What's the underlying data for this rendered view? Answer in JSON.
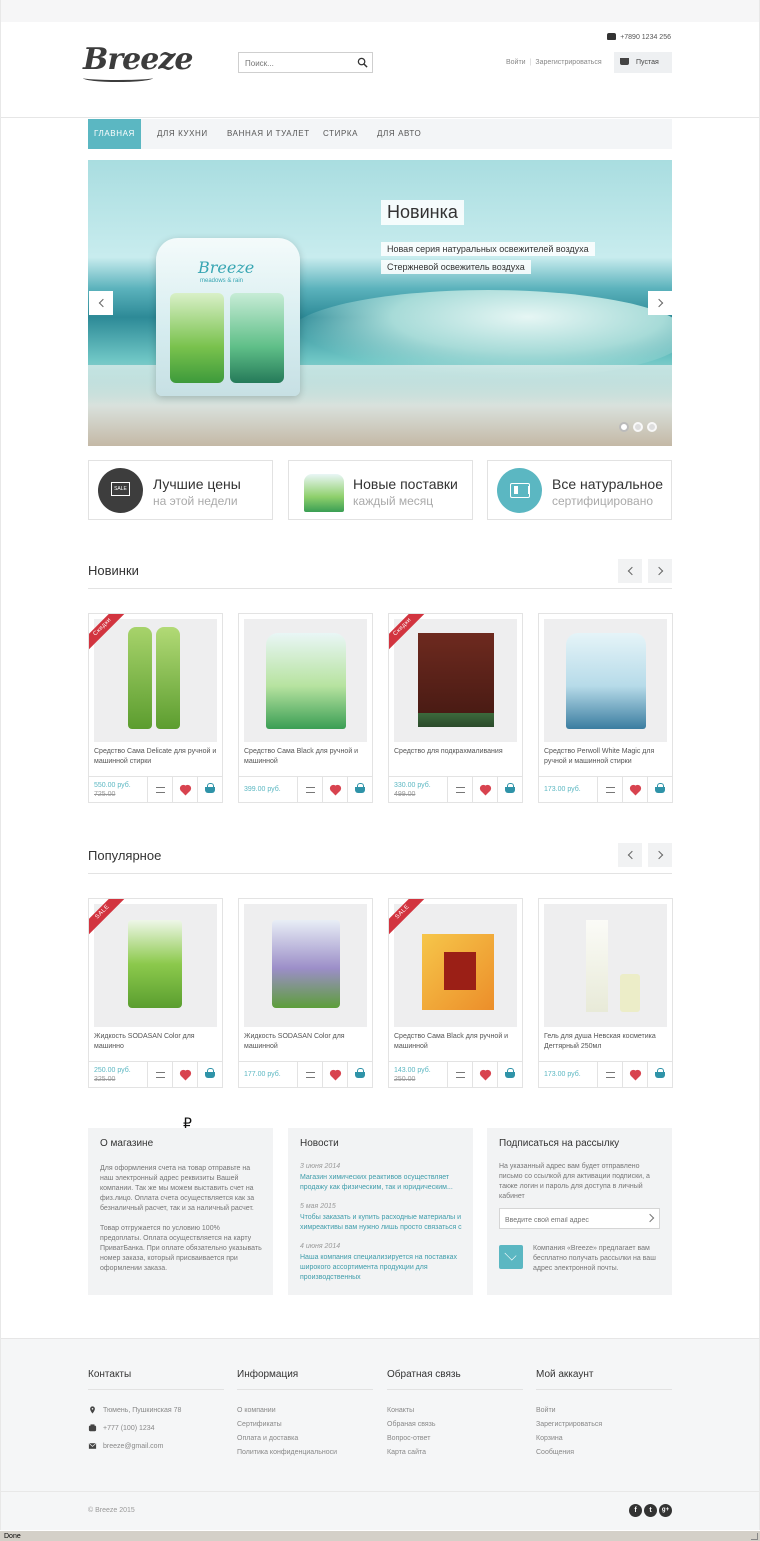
{
  "header": {
    "logo": "Breeze",
    "search_placeholder": "Поиск...",
    "phone": "+7890 1234 256",
    "login": "Войти",
    "register": "Зарегистрироваться",
    "cart": "Пустая"
  },
  "nav": {
    "items": [
      "ГЛАВНАЯ",
      "ДЛЯ КУХНИ",
      "ВАННАЯ И ТУАЛЕТ",
      "СТИРКА",
      "ДЛЯ АВТО"
    ]
  },
  "slider": {
    "title": "Новинка",
    "line1": "Новая серия натуральных освежителей воздуха",
    "line2": "Стержневой освежитель воздуха",
    "pack_brand": "Breeze",
    "pack_sub": "meadows & rain"
  },
  "features": [
    {
      "title": "Лучшие цены",
      "sub": "на этой недели",
      "icon": "sale-icon",
      "badge": "SALE"
    },
    {
      "title": "Новые поставки",
      "sub": "каждый месяц",
      "icon": "product-pack-icon"
    },
    {
      "title": "Все натуральное",
      "sub": "сертифицировано",
      "icon": "certificate-icon"
    }
  ],
  "new_section": {
    "title": "Новинки",
    "products": [
      {
        "name": "Средство Сама Delicate для ручной и машинной стирки",
        "price": "550.00 руб.",
        "old": "725.00",
        "ribbon": "Скидки"
      },
      {
        "name": "Средство Сама Black для ручной и машинной",
        "price": "399.00 руб.",
        "old": "",
        "ribbon": ""
      },
      {
        "name": "Средство для подкрахмаливания",
        "price": "330.00 руб.",
        "old": "499.00",
        "ribbon": "Скидки"
      },
      {
        "name": "Средство Perwoll White Magic для ручной и машинной стирки",
        "price": "173.00 руб.",
        "old": "",
        "ribbon": ""
      }
    ]
  },
  "popular_section": {
    "title": "Популярное",
    "products": [
      {
        "name": "Жидкость SODASAN Color для машинно",
        "price": "250.00 руб.",
        "old": "325.00",
        "ribbon": "SALE"
      },
      {
        "name": "Жидкость SODASAN Color для машинной",
        "price": "177.00 руб.",
        "old": "",
        "ribbon": ""
      },
      {
        "name": "Средство Сама Black для ручной и машинной",
        "price": "143.00 руб.",
        "old": "250.00",
        "ribbon": "SALE"
      },
      {
        "name": "Гель для душа Невская косметика Дегтярный 250мл",
        "price": "173.00 руб.",
        "old": "",
        "ribbon": ""
      }
    ]
  },
  "stray_glyph": "₽",
  "about": {
    "title": "О магазине",
    "p1": "Для оформления счета на товар отправьте на наш электронный адрес реквизиты Вашей компании. Так же мы можем выставить счет на физ.лицо. Оплата счета осуществляется как за безналичный расчет, так и за наличный расчет.",
    "p2": "Товар отгружается по условию 100% предоплаты. Оплата осуществляется на карту ПриватБанка. При оплате обязательно указывать номер заказа, который присваивается при оформлении заказа."
  },
  "news": {
    "title": "Новости",
    "items": [
      {
        "date": "3 июня 2014",
        "text": "Магазин химических реактивов осуществляет продажу как физическим, так и юридическим..."
      },
      {
        "date": "5 мая 2015",
        "text": "Чтобы заказать и купить расходные материалы и химреактивы вам нужно лишь просто связаться с"
      },
      {
        "date": "4 июня 2014",
        "text": "Наша компания специализируется на поставках широкого ассортимента продукции для производственных"
      }
    ]
  },
  "subscribe": {
    "title": "Подписаться на рассылку",
    "text": "На указанный адрес вам будет отправлено письмо со ссылкой для активации подписки, а также логин и пароль для доступа в личный кабинет",
    "email_placeholder": "Введите свой email адрес",
    "note": "Компания «Breeze» предлагает вам бесплатно получать рассылки на ваш адрес электронной почты."
  },
  "footer": {
    "contacts": {
      "title": "Контакты",
      "address": "Тюмень, Пушкинская 78",
      "phone": "+777 (100) 1234",
      "email": "breeze@gmail.com"
    },
    "info": {
      "title": "Информация",
      "links": [
        "О компании",
        "Сертификаты",
        "Оплата и доставка",
        "Политика конфиденциальноси"
      ]
    },
    "feedback": {
      "title": "Обратная связь",
      "links": [
        "Конакты",
        "Обраная связь",
        "Вопрос-ответ",
        "Карта сайта"
      ]
    },
    "account": {
      "title": "Мой аккаунт",
      "links": [
        "Войти",
        "Зарегистрироваться",
        "Корзина",
        "Сообщения"
      ]
    },
    "copyright": "© Breeze 2015",
    "social": [
      "f",
      "t",
      "g+"
    ]
  },
  "status": "Done",
  "colors": {
    "accent": "#5bb7c2",
    "sale": "#d2343f",
    "heart": "#d8434f"
  }
}
